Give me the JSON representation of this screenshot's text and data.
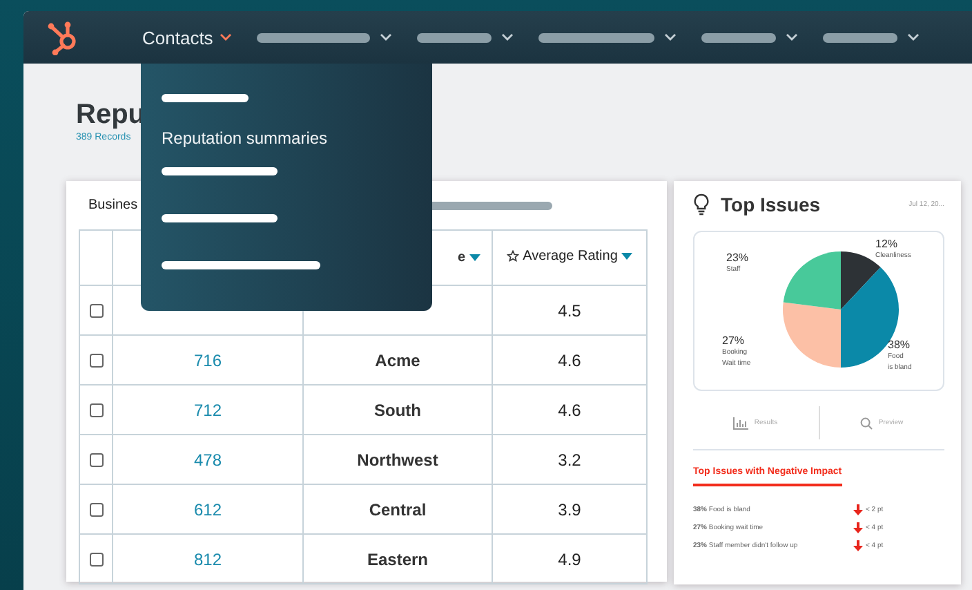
{
  "nav": {
    "items": [
      {
        "label": "Contacts",
        "kind": "text",
        "selected": true
      },
      {
        "kind": "placeholder"
      },
      {
        "kind": "placeholder"
      },
      {
        "kind": "placeholder"
      },
      {
        "kind": "placeholder"
      },
      {
        "kind": "placeholder"
      }
    ]
  },
  "dropdown": {
    "items": [
      {
        "kind": "placeholder"
      },
      {
        "kind": "text",
        "label": "Reputation summaries"
      },
      {
        "kind": "placeholder"
      },
      {
        "kind": "placeholder"
      },
      {
        "kind": "placeholder"
      }
    ]
  },
  "page": {
    "title": "Repu",
    "subtitle": "389 Records"
  },
  "table": {
    "tab": "Busines",
    "columns": [
      {
        "label": "e",
        "sortable": true
      },
      {
        "label": "Average Rating",
        "sortable": true
      }
    ],
    "rows": [
      {
        "checked": false,
        "id": "",
        "region": "",
        "rating": "4.5"
      },
      {
        "checked": false,
        "id": "716",
        "region": "Acme",
        "rating": "4.6"
      },
      {
        "checked": false,
        "id": "712",
        "region": "South",
        "rating": "4.6"
      },
      {
        "checked": false,
        "id": "478",
        "region": "Northwest",
        "rating": "3.2"
      },
      {
        "checked": false,
        "id": "612",
        "region": "Central",
        "rating": "3.9"
      },
      {
        "checked": false,
        "id": "812",
        "region": "Eastern",
        "rating": "4.9"
      }
    ]
  },
  "issues": {
    "title": "Top Issues",
    "date": "Jul 12, 20...",
    "chart_data": {
      "type": "pie",
      "categories": [
        "Cleanliness",
        "Food is bland",
        "Booking Wait time",
        "Staff"
      ],
      "values": [
        12,
        38,
        27,
        23
      ],
      "value_labels": [
        "12%",
        "38%",
        "27%",
        "23%"
      ],
      "colors": [
        "#2d3236",
        "#0b89a8",
        "#fcc0a6",
        "#48c99a"
      ],
      "data_labels": true
    },
    "buttons": [
      "Results",
      "Preview"
    ],
    "negative_title": "Top Issues with Negative Impact",
    "negative": [
      {
        "text": "**38%** Food is bland",
        "change": "< 2 pt"
      },
      {
        "text": "**27%** Booking wait time",
        "change": "< 4 pt"
      },
      {
        "text": "**23%** Staff member didn't follow up",
        "change": "< 4 pt"
      }
    ]
  }
}
